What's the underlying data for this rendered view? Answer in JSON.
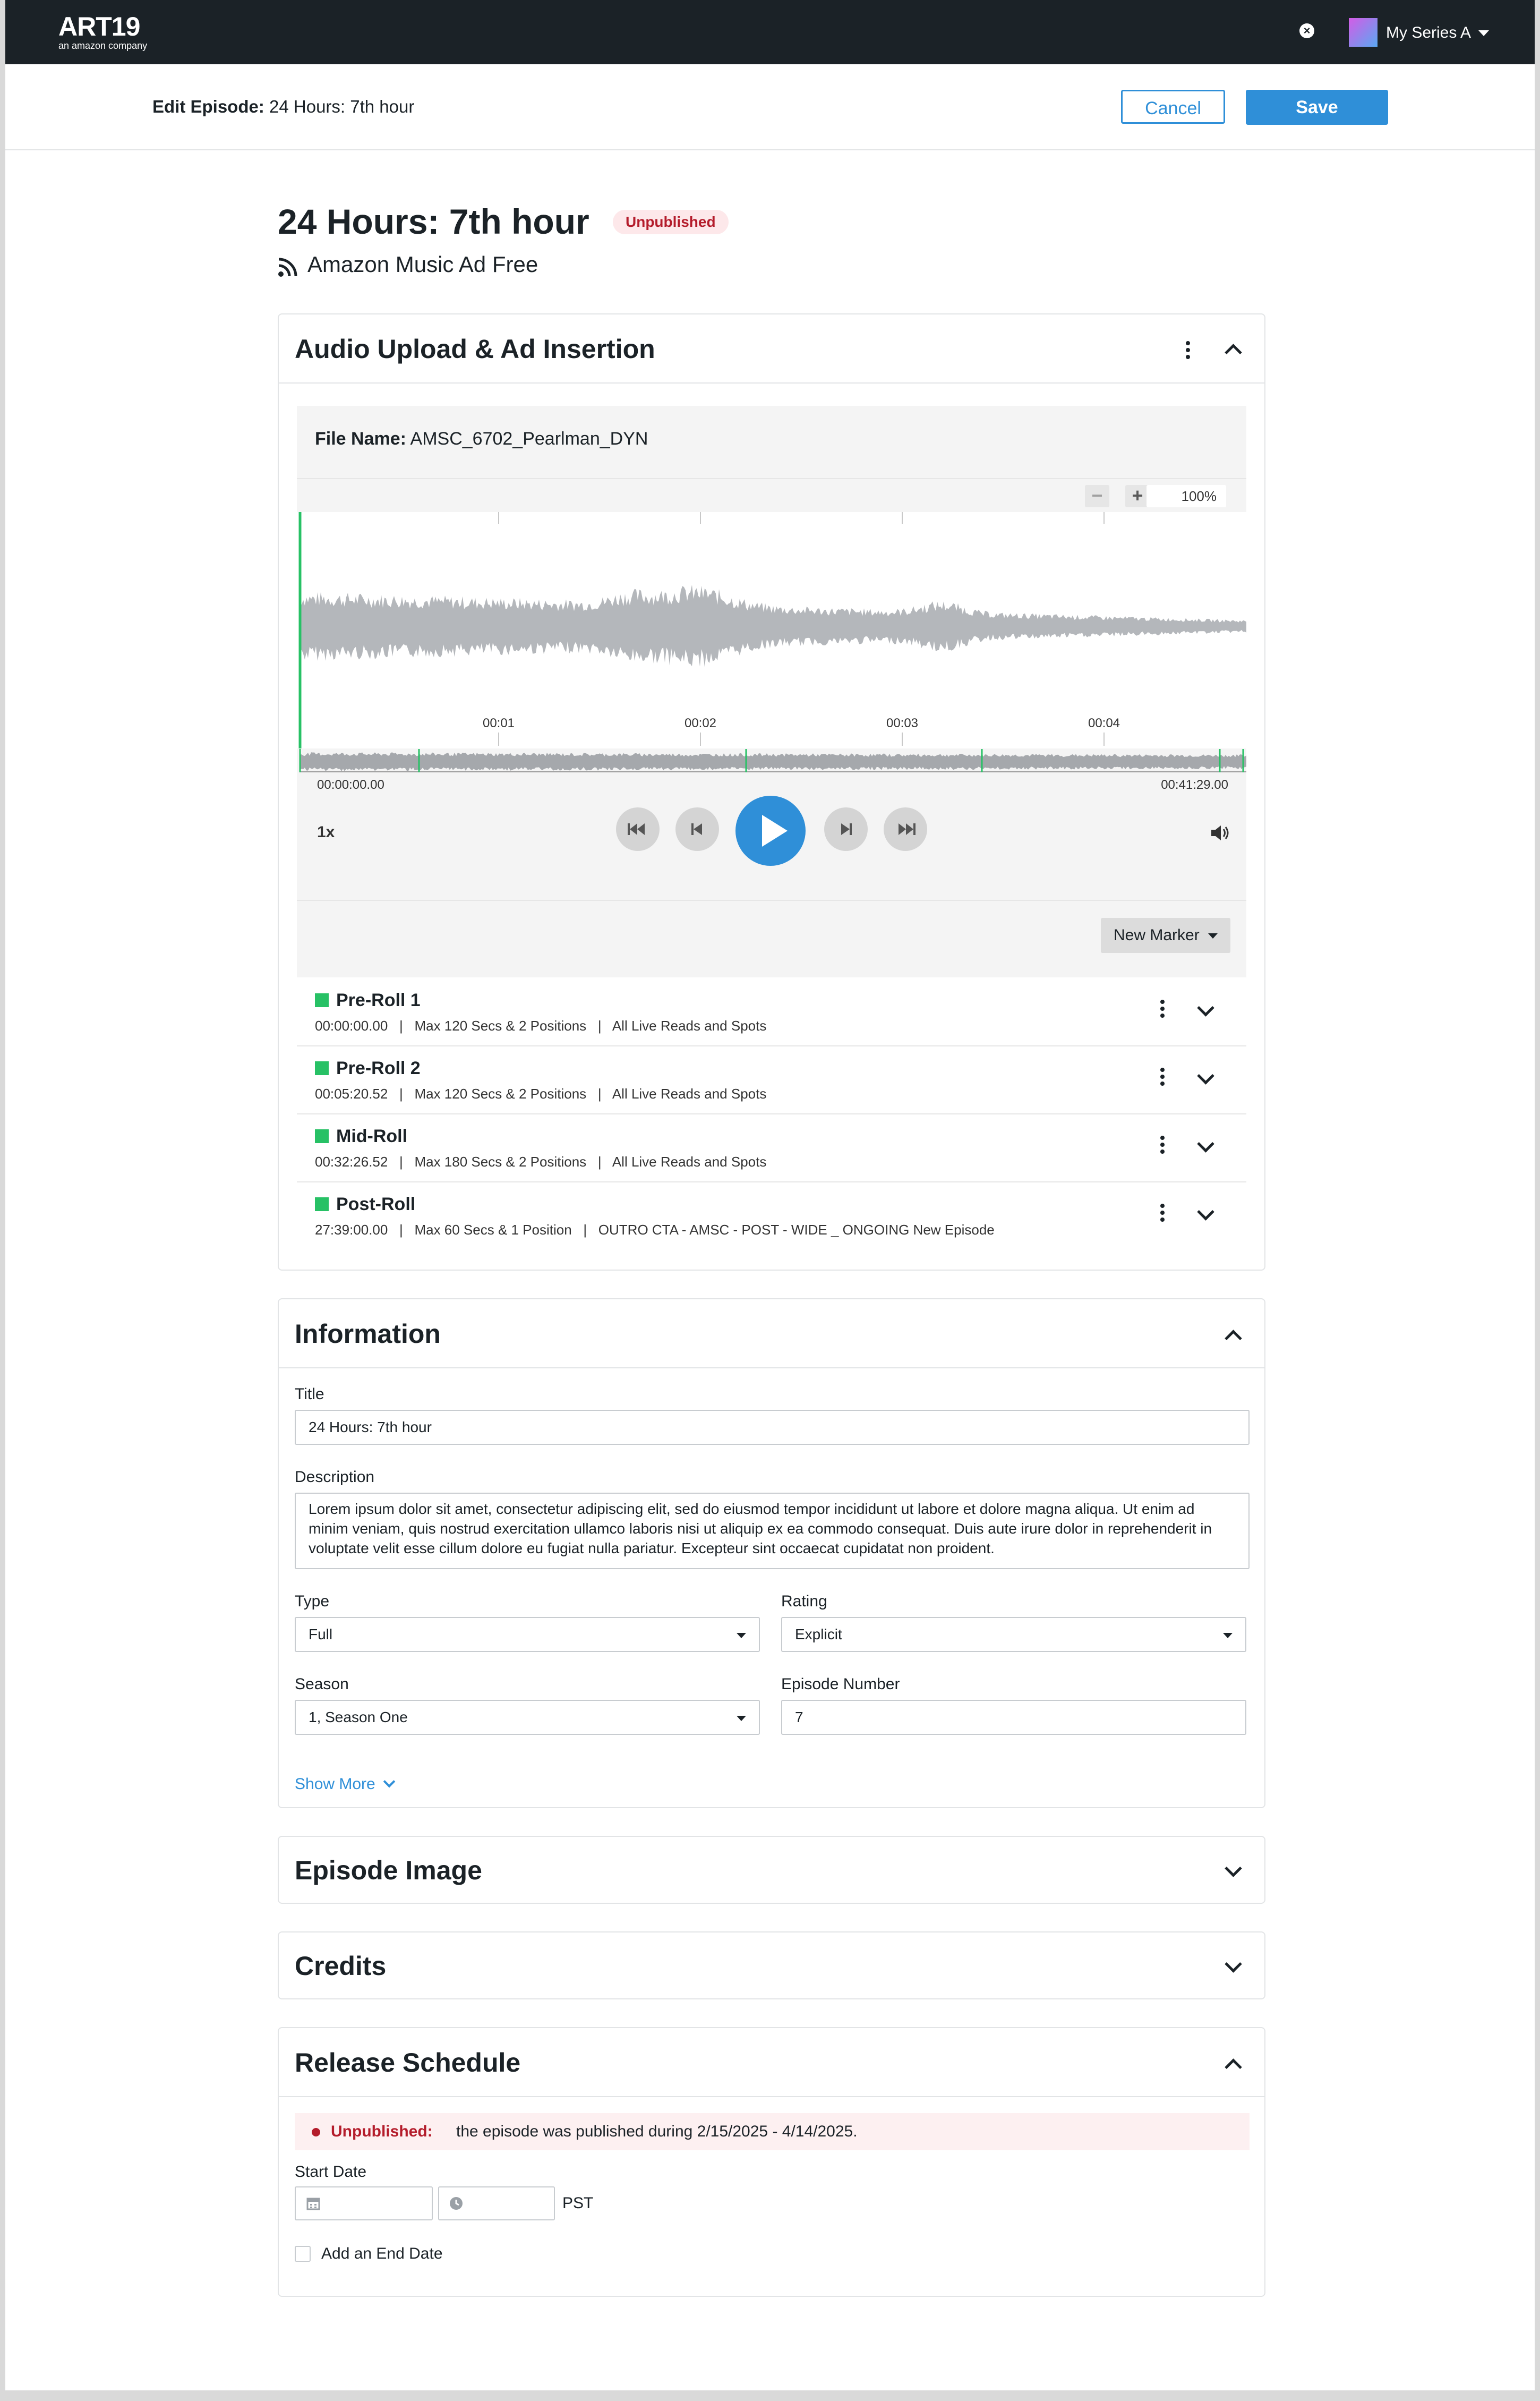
{
  "brand": {
    "logo_text": "ART19",
    "logo_tagline": "an amazon company",
    "accent": "#2f8fd8"
  },
  "nav": {
    "series_name": "My Series A"
  },
  "edit_bar": {
    "prefix": "Edit Episode:",
    "episode_name": "24 Hours: 7th hour",
    "cancel_label": "Cancel",
    "save_label": "Save"
  },
  "episode": {
    "title": "24 Hours: 7th hour",
    "status_badge": "Unpublished",
    "feed_name": "Amazon Music Ad Free"
  },
  "audio": {
    "section_title": "Audio Upload & Ad Insertion",
    "file_label": "File Name:",
    "file_name": "AMSC_6702_Pearlman_DYN",
    "zoom_minus": "−",
    "zoom_plus": "+",
    "zoom_level": "100%",
    "timeline_ticks": [
      "00:01",
      "00:02",
      "00:03",
      "00:04"
    ],
    "time_start": "00:00:00.00",
    "time_end": "00:41:29.00",
    "playback_speed": "1x",
    "new_marker_label": "New Marker",
    "markers": [
      {
        "name": "Pre-Roll 1",
        "meta": "00:00:00.00   |   Max 120 Secs & 2 Positions   |   All Live Reads and Spots"
      },
      {
        "name": "Pre-Roll 2",
        "meta": "00:05:20.52   |   Max 120 Secs & 2 Positions   |   All Live Reads and Spots"
      },
      {
        "name": "Mid-Roll",
        "meta": "00:32:26.52   |   Max 180 Secs & 2 Positions   |   All Live Reads and Spots"
      },
      {
        "name": "Post-Roll",
        "meta": "27:39:00.00   |   Max 60 Secs & 1 Position   |   OUTRO CTA - AMSC - POST - WIDE _ ONGOING New Episode"
      }
    ],
    "marker_color": "#27c165"
  },
  "information": {
    "section_title": "Information",
    "title_label": "Title",
    "title_value": "24 Hours: 7th hour",
    "description_label": "Description",
    "description_value": "Lorem ipsum dolor sit amet, consectetur adipiscing elit, sed do eiusmod tempor incididunt ut labore et dolore magna aliqua. Ut enim ad minim veniam, quis nostrud exercitation ullamco laboris nisi ut aliquip ex ea commodo consequat. Duis aute irure dolor in reprehenderit in voluptate velit esse cillum dolore eu fugiat nulla pariatur. Excepteur sint occaecat cupidatat non proident.",
    "type_label": "Type",
    "type_value": "Full",
    "rating_label": "Rating",
    "rating_value": "Explicit",
    "season_label": "Season",
    "season_value": "1, Season One",
    "episode_number_label": "Episode Number",
    "episode_number_value": "7",
    "show_more_label": "Show More"
  },
  "episode_image": {
    "section_title": "Episode Image"
  },
  "credits": {
    "section_title": "Credits"
  },
  "release": {
    "section_title": "Release Schedule",
    "alert_strong": "Unpublished:",
    "alert_text": "the episode was published during 2/15/2025 - 4/14/2025.",
    "start_date_label": "Start Date",
    "timezone": "PST",
    "end_date_label": "Add an End Date"
  }
}
